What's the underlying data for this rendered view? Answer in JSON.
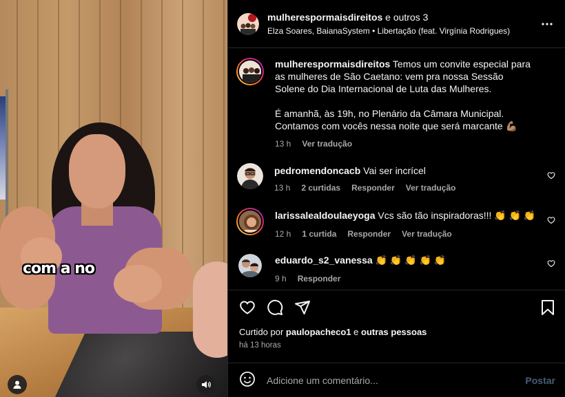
{
  "header": {
    "username": "mulherespormaisdireitos",
    "collab_suffix": " e outros 3",
    "audio": "Elza Soares, BaianaSystem • Libertação (feat. Virgínia Rodrigues)"
  },
  "video": {
    "caption_overlay": "com a no"
  },
  "post_caption": {
    "username": "mulherespormaisdireitos",
    "text": "Temos um convite especial para as mulheres de São Caetano: vem pra nossa Sessão Solene do Dia Internacional de Luta das Mulheres.\n\nÉ amanhã, às 19h, no Plenário da Câmara Municipal. Contamos com vocês nessa noite que será marcante 💪🏽",
    "time": "13 h",
    "translate": "Ver tradução"
  },
  "comments": [
    {
      "username": "pedromendoncacb",
      "text": "Vai ser incrícel",
      "time": "13 h",
      "likes": "2 curtidas",
      "reply": "Responder",
      "translate": "Ver tradução"
    },
    {
      "username": "larissalealdoulaeyoga",
      "text": "Vcs são tão inspiradoras!!! 👏 👏 👏",
      "time": "12 h",
      "likes": "1 curtida",
      "reply": "Responder",
      "translate": "Ver tradução"
    },
    {
      "username": "eduardo_s2_vanessa",
      "text": "👏 👏 👏 👏 👏",
      "time": "9 h",
      "reply": "Responder"
    }
  ],
  "likes": {
    "prefix": "Curtido por ",
    "user": "paulopacheco1",
    "middle": " e ",
    "others": "outras pessoas"
  },
  "posted_ago": "há 13 horas",
  "add_comment": {
    "placeholder": "Adicione um comentário...",
    "post_label": "Postar"
  },
  "colors": {
    "background": "#000000",
    "secondary_text": "#a8a8a8",
    "post_button_disabled": "#4a5d77",
    "divider": "#262626"
  }
}
